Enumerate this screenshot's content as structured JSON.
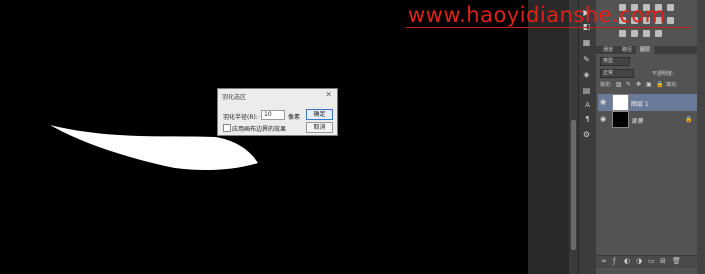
{
  "watermark": "www.haoyidianshe.com",
  "dialog": {
    "title": "羽化选区",
    "close_glyph": "✕",
    "feather_label": "羽化半径(R):",
    "feather_value": "10",
    "unit": "像素",
    "ok_label": "确定",
    "cancel_label": "取消",
    "edge_checkbox_label": "应用画布边界的效果"
  },
  "panel": {
    "tabs": [
      "通道",
      "路径",
      "图层"
    ],
    "filter_kind": "类型",
    "blend_mode": "正常",
    "opacity_label": "不透明度:",
    "fill_label": "填充:",
    "lock_label": "锁定:",
    "layers": [
      {
        "name": "图层 1",
        "selected": true,
        "thumb": "white"
      },
      {
        "name": "背景",
        "selected": false,
        "thumb": "black"
      }
    ]
  },
  "tools": {
    "A": "A",
    "para": "¶"
  },
  "colors": {
    "canvas": "#000000",
    "panel": "#535353",
    "selected_layer": "#6a7a99",
    "watermark": "#e0201a"
  }
}
